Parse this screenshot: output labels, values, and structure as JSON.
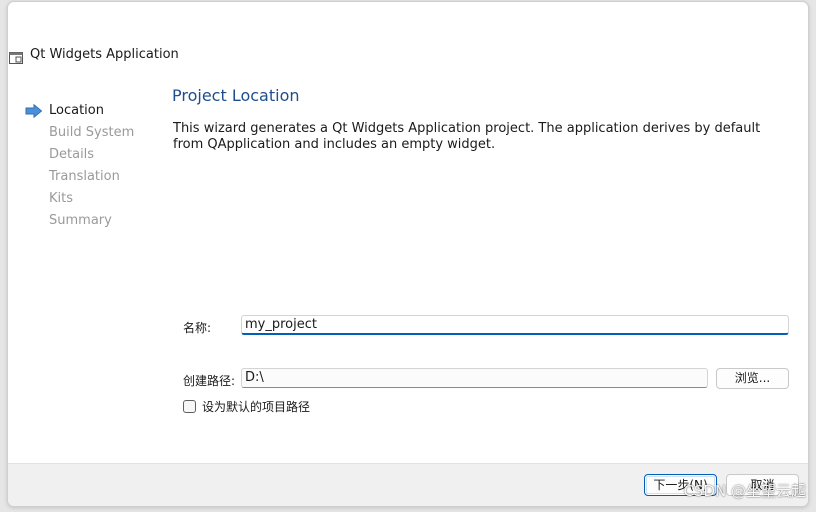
{
  "app": {
    "title": "Qt Widgets Application",
    "icon": "qt-app-window-icon"
  },
  "steps": {
    "current_icon": "arrow-right-icon",
    "items": [
      {
        "label": "Location",
        "current": true
      },
      {
        "label": "Build System",
        "current": false
      },
      {
        "label": "Details",
        "current": false
      },
      {
        "label": "Translation",
        "current": false
      },
      {
        "label": "Kits",
        "current": false
      },
      {
        "label": "Summary",
        "current": false
      }
    ]
  },
  "page": {
    "title": "Project Location",
    "description": "This wizard generates a Qt Widgets Application project. The application derives by default from QApplication and includes an empty widget."
  },
  "form": {
    "name_label": "名称:",
    "name_value": "my_project",
    "path_label": "创建路径:",
    "path_value": "D:\\",
    "browse_label": "浏览...",
    "default_path_label": "设为默认的项目路径",
    "default_path_checked": false
  },
  "footer": {
    "next_label": "下一步(N)",
    "cancel_label": "取消"
  },
  "watermark": "CSDN @坐望云起",
  "colors": {
    "accent": "#005fb8",
    "title": "#1f4e8c",
    "arrow": "#4a90d9",
    "disabled_text": "#9a9a9a"
  }
}
